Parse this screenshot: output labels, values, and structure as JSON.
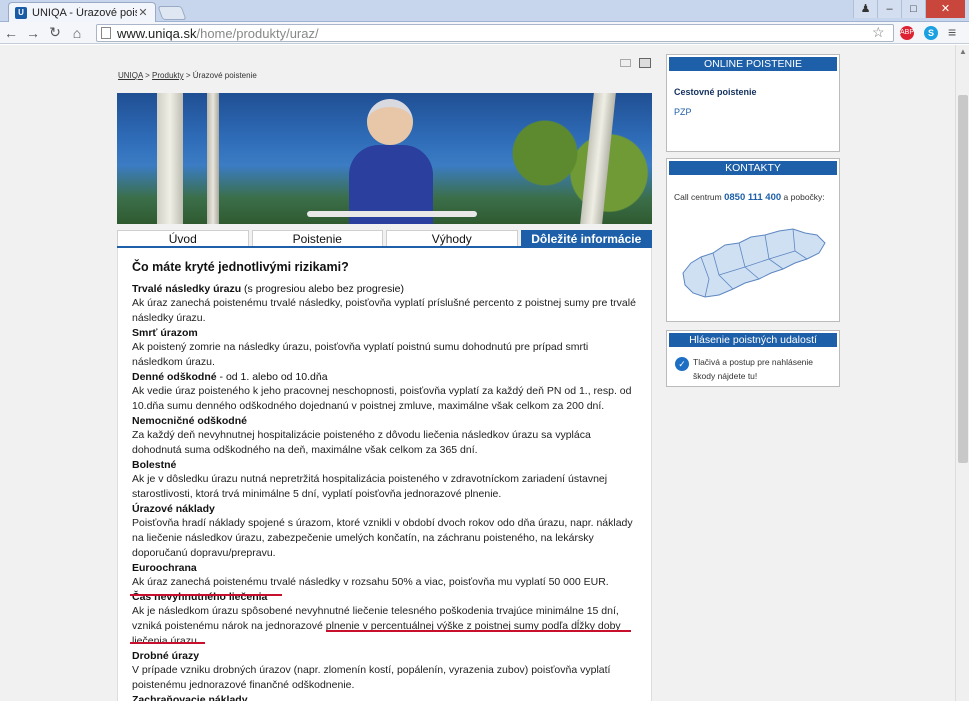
{
  "browser": {
    "tab_title": "UNIQA - Úrazové poistenie",
    "url_host": "www.uniqa.sk",
    "url_path": "/home/produkty/uraz/"
  },
  "breadcrumb": {
    "items": [
      "UNIQA",
      "Produkty",
      "Úrazové poistenie"
    ],
    "separator": ">"
  },
  "tabs": [
    {
      "label": "Úvod",
      "active": false
    },
    {
      "label": "Poistenie",
      "active": false
    },
    {
      "label": "Výhody",
      "active": false
    },
    {
      "label": "Dôležité informácie",
      "active": true
    }
  ],
  "content": {
    "heading": "Čo máte kryté jednotlivými rizikami?",
    "items": [
      {
        "title": "Trvalé následky úrazu",
        "title_suffix": " (s progresiou alebo bez progresie)",
        "text": "Ak úraz zanechá poistenému trvalé následky, poisťovňa vyplatí príslušné percento z poistnej sumy pre trvalé následky úrazu."
      },
      {
        "title": "Smrť úrazom",
        "title_suffix": "",
        "text": "Ak poistený zomrie na následky úrazu, poisťovňa vyplatí poistnú sumu dohodnutú pre prípad smrti následkom úrazu."
      },
      {
        "title": "Denné odškodné",
        "title_suffix": " - od 1. alebo od 10.dňa",
        "text": "Ak vedie úraz poisteného k jeho pracovnej neschopnosti, poisťovňa vyplatí za každý deň PN od 1., resp. od 10.dňa sumu denného odškodného dojednanú v poistnej zmluve, maximálne však celkom za 200 dní."
      },
      {
        "title": "Nemocničné odškodné",
        "title_suffix": "",
        "text": "Za každý deň nevyhnutnej hospitalizácie poisteného z dôvodu liečenia následkov úrazu sa vypláca dohodnutá suma odškodného na deň, maximálne však celkom za 365 dní."
      },
      {
        "title": "Bolestné",
        "title_suffix": "",
        "text": "Ak je v dôsledku úrazu nutná nepretržitá hospitalizácia poisteného v zdravotníckom zariadení ústavnej starostlivosti, ktorá trvá minimálne 5 dní, vyplatí poisťovňa jednorazové plnenie."
      },
      {
        "title": "Úrazové náklady",
        "title_suffix": "",
        "text": "Poisťovňa hradí náklady spojené s úrazom, ktoré vznikli v období dvoch rokov odo dňa úrazu, napr. náklady na liečenie následkov úrazu, zabezpečenie umelých končatín, na záchranu poisteného, na lekársky doporučanú dopravu/prepravu."
      },
      {
        "title": "Euroochrana",
        "title_suffix": "",
        "text": "Ak úraz zanechá poistenému trvalé následky v rozsahu 50% a viac, poisťovňa mu vyplatí 50 000 EUR."
      },
      {
        "title": "Čas nevyhnutného liečenia",
        "title_suffix": "",
        "text": "Ak je následkom úrazu spôsobené nevyhnutné liečenie telesného poškodenia trvajúce minimálne 15 dní, vzniká poistenému nárok na jednorazové plnenie v percentuálnej výške z poistnej sumy podľa dĺžky doby liečenia úrazu."
      },
      {
        "title": "Drobné úrazy",
        "title_suffix": "",
        "text": "V prípade vzniku drobných úrazov (napr. zlomenín kostí, popálenín, vyrazenia zubov) poisťovňa vyplatí poistenému jednorazové finančné odškodnenie."
      },
      {
        "title": "Zachraňovacie náklady",
        "title_suffix": "",
        "text": ""
      }
    ]
  },
  "sidebar": {
    "online": {
      "heading": "ONLINE POISTENIE",
      "links": [
        "Cestovné poistenie",
        "PZP"
      ]
    },
    "contacts": {
      "heading": "KONTAKTY",
      "prefix": "Call centrum",
      "phone": "0850 111 400",
      "suffix": "a pobočky:"
    },
    "claims": {
      "heading": "Hlásenie poistných udalostí",
      "text": "Tlačivá a postup pre nahlásenie škody nájdete tu!"
    }
  },
  "colors": {
    "brand_blue": "#1d5fa8",
    "annotation_red": "#c8102e"
  }
}
